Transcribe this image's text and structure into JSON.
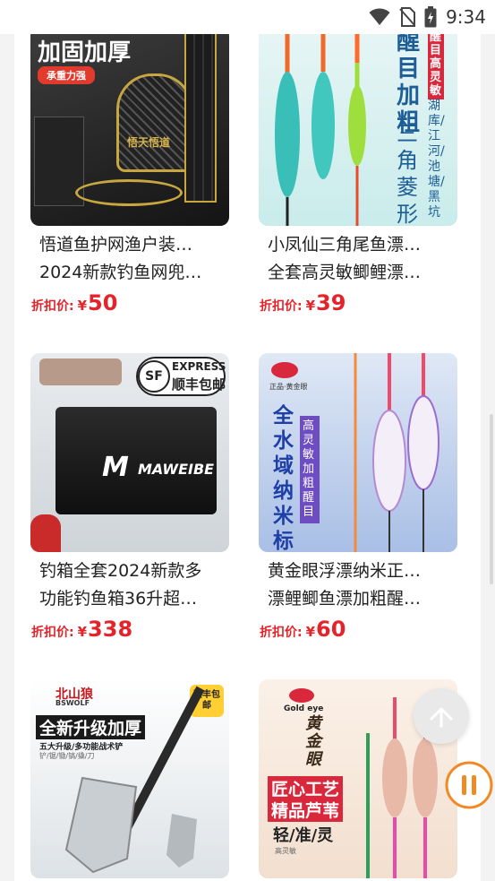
{
  "status_bar": {
    "time": "9:34"
  },
  "products": [
    {
      "title_line1": "悟道鱼护网渔户装…",
      "title_line2": "2024新款钓鱼网兜…",
      "price_label": "折扣价:",
      "currency": "¥",
      "price": "50",
      "image": {
        "banner": "加固加厚",
        "tag": "承重力强",
        "brand_text": "悟天悟道"
      }
    },
    {
      "title_line1": "小凤仙三角尾鱼漂…",
      "title_line2": "全套高灵敏鲫鲤漂…",
      "price_label": "折扣价:",
      "currency": "¥",
      "price": "39",
      "image": {
        "banner": "醒目加粗",
        "side_label": "醒目高灵敏",
        "sub_text": "三角菱形尾",
        "side_text": "湖库/江河/池塘/黑坑"
      }
    },
    {
      "title_line1": "钓箱全套2024新款多",
      "title_line2": "功能钓鱼箱36升超…",
      "price_label": "折扣价:",
      "currency": "¥",
      "price": "338",
      "image": {
        "express_en": "EXPRESS",
        "express_cn": "顺丰包邮",
        "sf_logo": "SF",
        "brand": "MAWEIBE"
      }
    },
    {
      "title_line1": "黄金眼浮漂纳米正…",
      "title_line2": "漂鲤鲫鱼漂加粗醒…",
      "price_label": "折扣价:",
      "currency": "¥",
      "price": "60",
      "image": {
        "banner": "全水域纳米标",
        "side_label": "高灵敏 加粗醒目",
        "small_brand": "正品·黄金眼"
      }
    },
    {
      "title_line1": "",
      "title_line2": "",
      "price_label": "",
      "currency": "",
      "price": "",
      "image": {
        "brand": "北山狼",
        "brand_en": "BSWOLF",
        "banner": "全新升级加厚",
        "sub_text": "五大升级/多功能战术铲",
        "sub_text2": "铲/锯/锄/镐/撬/刀",
        "corner": "顺丰包邮"
      }
    },
    {
      "title_line1": "",
      "title_line2": "",
      "price_label": "",
      "currency": "",
      "price": "",
      "image": {
        "brand_en": "Gold eye",
        "vertical": "黄金眼",
        "banner1": "匠心工艺",
        "banner2": "精品芦苇",
        "tagline": "轻/准/灵",
        "small": "高灵敏"
      }
    }
  ],
  "colors": {
    "price_red": "#e4242b",
    "accent_orange": "#f08a24"
  },
  "icons": [
    "wifi-icon",
    "no-sim-icon",
    "battery-icon",
    "arrow-up-icon",
    "pause-icon"
  ]
}
